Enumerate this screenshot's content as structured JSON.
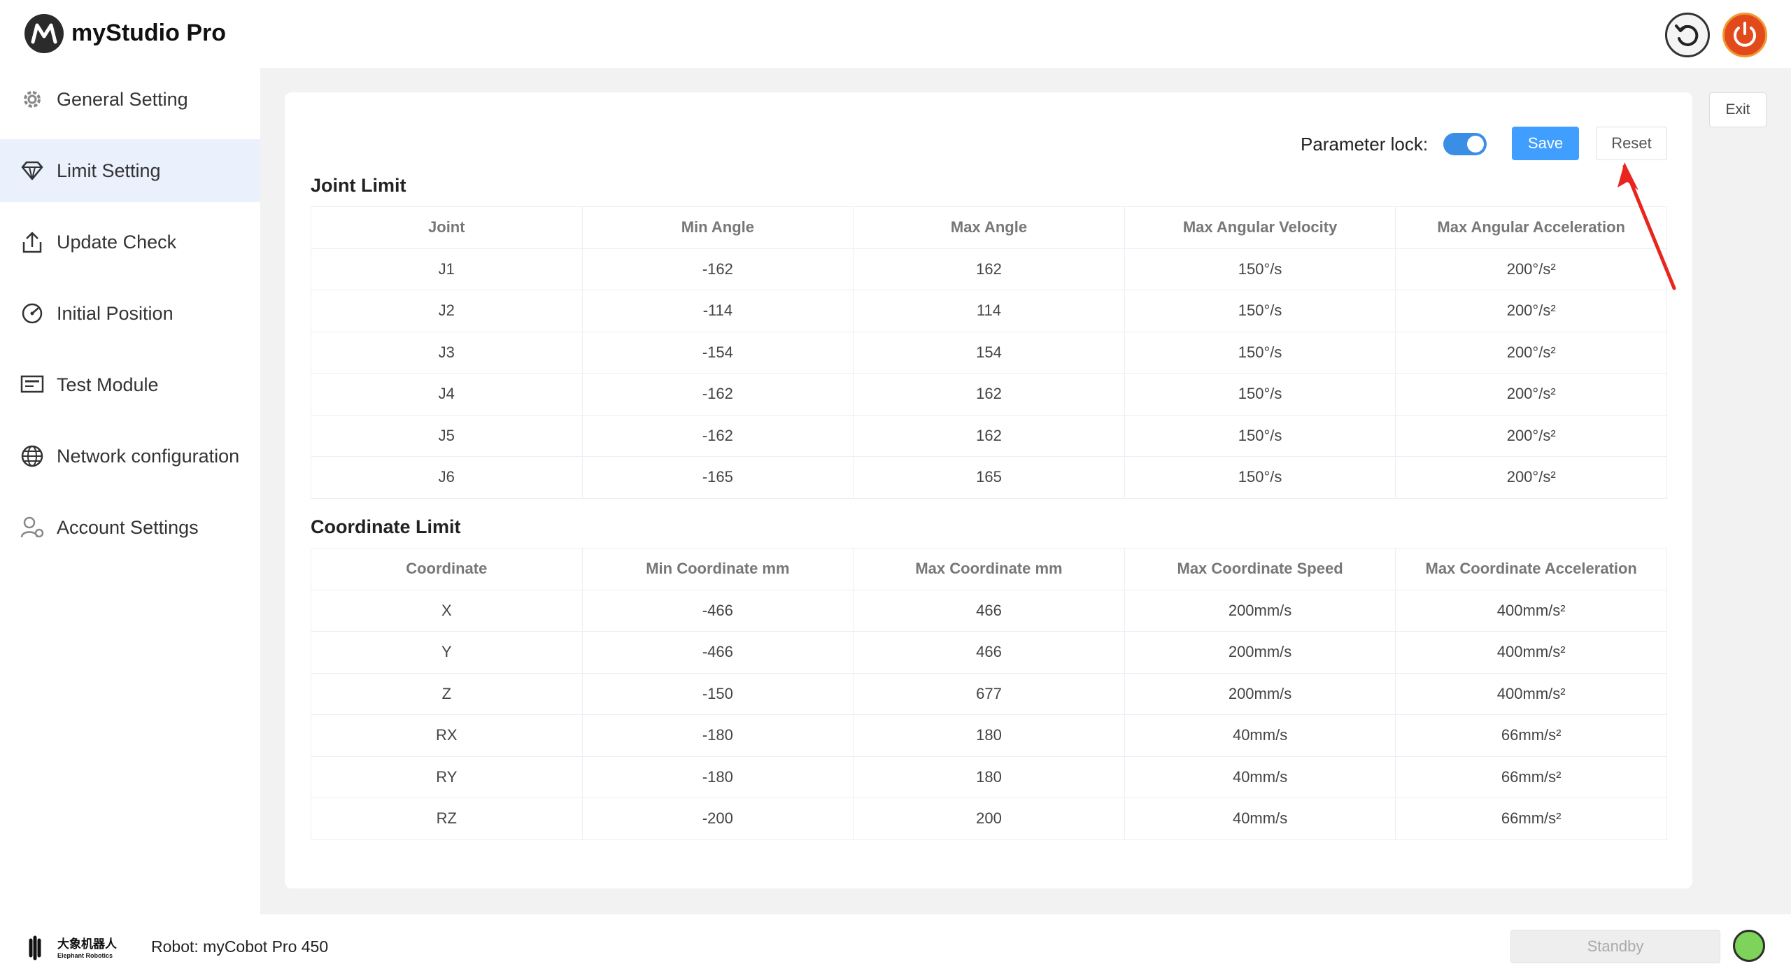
{
  "app": {
    "title": "myStudio Pro",
    "exit_label": "Exit"
  },
  "sidebar": {
    "items": [
      {
        "label": "General Setting",
        "icon": "gear-icon"
      },
      {
        "label": "Limit Setting",
        "icon": "diamond-limit-icon",
        "active": true
      },
      {
        "label": "Update Check",
        "icon": "upload-icon"
      },
      {
        "label": "Initial Position",
        "icon": "gauge-icon"
      },
      {
        "label": "Test Module",
        "icon": "test-icon"
      },
      {
        "label": "Network configuration",
        "icon": "globe-icon"
      },
      {
        "label": "Account Settings",
        "icon": "user-gear-icon"
      }
    ]
  },
  "toolbar": {
    "lock_label": "Parameter lock:",
    "lock_on": true,
    "save_label": "Save",
    "reset_label": "Reset"
  },
  "joint_limit": {
    "title": "Joint Limit",
    "headers": [
      "Joint",
      "Min Angle",
      "Max Angle",
      "Max Angular Velocity",
      "Max Angular Acceleration"
    ],
    "rows": [
      [
        "J1",
        "-162",
        "162",
        "150°/s",
        "200°/s²"
      ],
      [
        "J2",
        "-114",
        "114",
        "150°/s",
        "200°/s²"
      ],
      [
        "J3",
        "-154",
        "154",
        "150°/s",
        "200°/s²"
      ],
      [
        "J4",
        "-162",
        "162",
        "150°/s",
        "200°/s²"
      ],
      [
        "J5",
        "-162",
        "162",
        "150°/s",
        "200°/s²"
      ],
      [
        "J6",
        "-165",
        "165",
        "150°/s",
        "200°/s²"
      ]
    ]
  },
  "coordinate_limit": {
    "title": "Coordinate Limit",
    "headers": [
      "Coordinate",
      "Min Coordinate mm",
      "Max Coordinate mm",
      "Max Coordinate Speed",
      "Max Coordinate Acceleration"
    ],
    "rows": [
      [
        "X",
        "-466",
        "466",
        "200mm/s",
        "400mm/s²"
      ],
      [
        "Y",
        "-466",
        "466",
        "200mm/s",
        "400mm/s²"
      ],
      [
        "Z",
        "-150",
        "677",
        "200mm/s",
        "400mm/s²"
      ],
      [
        "RX",
        "-180",
        "180",
        "40mm/s",
        "66mm/s²"
      ],
      [
        "RY",
        "-180",
        "180",
        "40mm/s",
        "66mm/s²"
      ],
      [
        "RZ",
        "-200",
        "200",
        "40mm/s",
        "66mm/s²"
      ]
    ]
  },
  "footer": {
    "brand_cn": "大象机器人",
    "brand_en": "Elephant Robotics",
    "robot_label": "Robot: myCobot Pro 450",
    "standby_label": "Standby",
    "status_color": "#7ed45a"
  },
  "colors": {
    "accent": "#409eff",
    "annotation": "#e8251f",
    "active_bg": "#eaf1fc"
  }
}
